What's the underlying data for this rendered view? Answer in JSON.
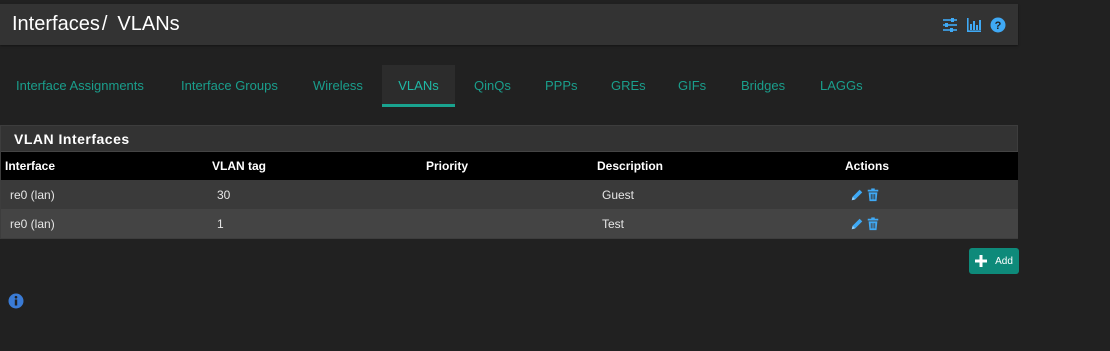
{
  "header": {
    "breadcrumb": [
      "Interfaces",
      "VLANs"
    ],
    "separator": "/"
  },
  "header_icons": [
    "sliders-icon",
    "bar-chart-icon",
    "help-icon"
  ],
  "tabs": [
    {
      "label": "Interface Assignments",
      "active": false
    },
    {
      "label": "Interface Groups",
      "active": false
    },
    {
      "label": "Wireless",
      "active": false
    },
    {
      "label": "VLANs",
      "active": true
    },
    {
      "label": "QinQs",
      "active": false
    },
    {
      "label": "PPPs",
      "active": false
    },
    {
      "label": "GREs",
      "active": false
    },
    {
      "label": "GIFs",
      "active": false
    },
    {
      "label": "Bridges",
      "active": false
    },
    {
      "label": "LAGGs",
      "active": false
    }
  ],
  "panel": {
    "title": "VLAN Interfaces",
    "columns": [
      "Interface",
      "VLAN tag",
      "Priority",
      "Description",
      "Actions"
    ],
    "rows": [
      {
        "interface": "re0 (lan)",
        "vlan_tag": "30",
        "priority": "",
        "description": "Guest"
      },
      {
        "interface": "re0 (lan)",
        "vlan_tag": "1",
        "priority": "",
        "description": "Test"
      }
    ]
  },
  "add_button": {
    "label": "Add"
  },
  "colors": {
    "background": "#212121",
    "panel": "#333333",
    "accent": "#1a9e8c",
    "link_icon": "#3fa9f5"
  }
}
